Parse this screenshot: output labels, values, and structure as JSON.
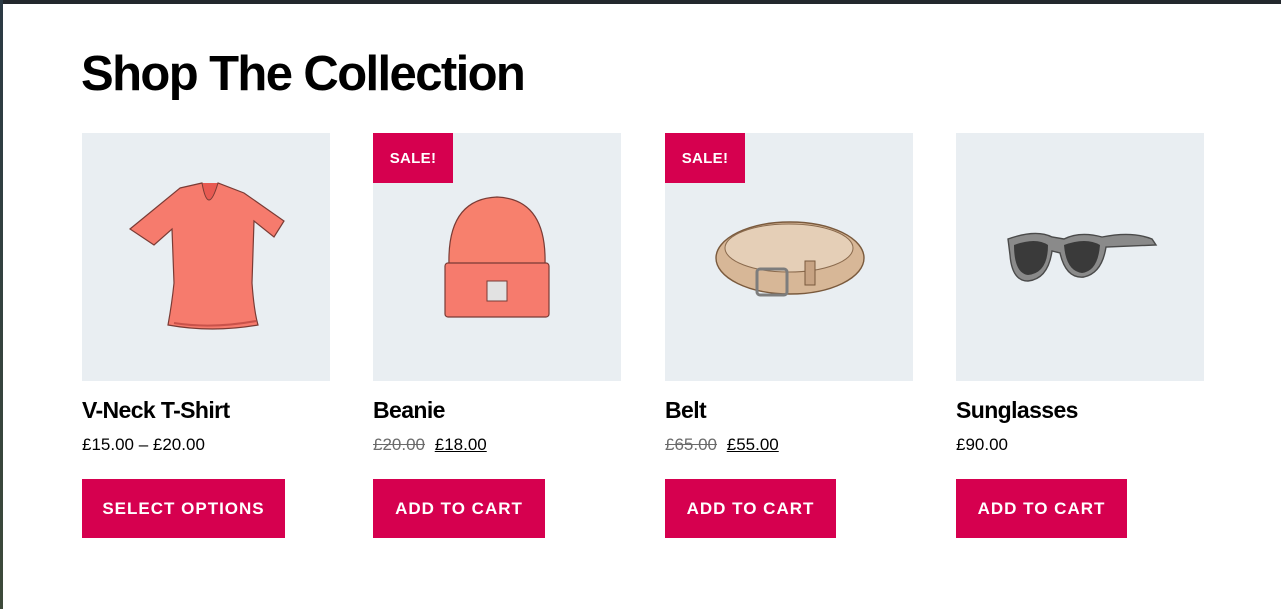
{
  "section": {
    "title": "Shop The Collection"
  },
  "products": [
    {
      "name": "V-Neck T-Shirt",
      "price": "£15.00 – £20.00",
      "button": "SELECT OPTIONS"
    },
    {
      "name": "Beanie",
      "sale_badge": "SALE!",
      "old_price": "£20.00",
      "new_price": "£18.00",
      "button": "ADD TO CART"
    },
    {
      "name": "Belt",
      "sale_badge": "SALE!",
      "old_price": "£65.00",
      "new_price": "£55.00",
      "button": "ADD TO CART"
    },
    {
      "name": "Sunglasses",
      "price": "£90.00",
      "button": "ADD TO CART"
    }
  ],
  "colors": {
    "accent": "#d6004f",
    "thumb_bg": "#e9eef2",
    "text": "#000000"
  },
  "icons": [
    "tshirt-image",
    "beanie-image",
    "belt-image",
    "sunglasses-image"
  ]
}
